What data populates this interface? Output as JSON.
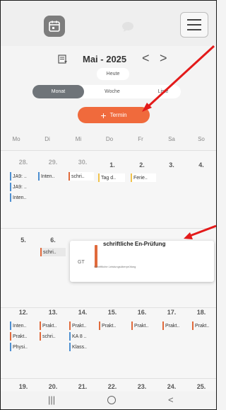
{
  "header": {
    "month_title": "Mai - 2025",
    "today_label": "Heute",
    "nav_prev": "<",
    "nav_next": ">"
  },
  "view_tabs": {
    "month": "Monat",
    "week": "Woche",
    "list": "Liste"
  },
  "add_button": {
    "plus": "+",
    "label": "Termin"
  },
  "weekdays": [
    "Mo",
    "Di",
    "Mi",
    "Do",
    "Fr",
    "Sa",
    "So"
  ],
  "weeks": [
    {
      "days": [
        "28.",
        "29.",
        "30.",
        "1.",
        "2.",
        "3.",
        "4."
      ],
      "events": [
        [
          "JA9: ..",
          "JA9: ..",
          "Inten.."
        ],
        [
          "Inten.."
        ],
        [
          "schri.."
        ],
        [
          "Tag d.."
        ],
        [
          "Ferie.."
        ],
        [],
        []
      ]
    },
    {
      "days": [
        "5.",
        "6.",
        "",
        "",
        "",
        "",
        ""
      ],
      "events": [
        [],
        [
          "schri.."
        ],
        [],
        [],
        [],
        [],
        []
      ]
    },
    {
      "days": [
        "12.",
        "13.",
        "14.",
        "15.",
        "16.",
        "17.",
        "18."
      ],
      "events": [
        [
          "Inten..",
          "Prakt..",
          "Physi.."
        ],
        [
          "Prakt..",
          "schri.."
        ],
        [
          "Prakt..",
          "KA 8 ..",
          "Klass.."
        ],
        [
          "Prakt.."
        ],
        [
          "Prakt.."
        ],
        [
          "Prakt.."
        ],
        [
          "Prakt.."
        ]
      ]
    },
    {
      "days": [
        "19.",
        "20.",
        "21.",
        "22.",
        "23.",
        "24.",
        "25."
      ],
      "events": [
        [],
        [],
        [],
        [],
        [],
        [],
        []
      ]
    }
  ],
  "popover": {
    "code": "GT",
    "title": "schriftliche En-Prüfung",
    "subtitle": "Schriftliche Leistungsüberprüfung"
  },
  "colors": {
    "accent": "#f06a3c",
    "event_blue": "#4d8fd1",
    "event_orange": "#e06a3c",
    "event_yellow": "#f0c24b",
    "annotation_red": "#e31a1a"
  },
  "icons": {
    "calendar": "calendar-icon",
    "chat": "chat-icon",
    "menu": "hamburger-menu-icon",
    "list": "list-view-icon",
    "recents": "recents-icon",
    "home": "home-icon",
    "back": "back-icon"
  },
  "bottom_nav": {
    "recents": "|||",
    "back": "<"
  }
}
